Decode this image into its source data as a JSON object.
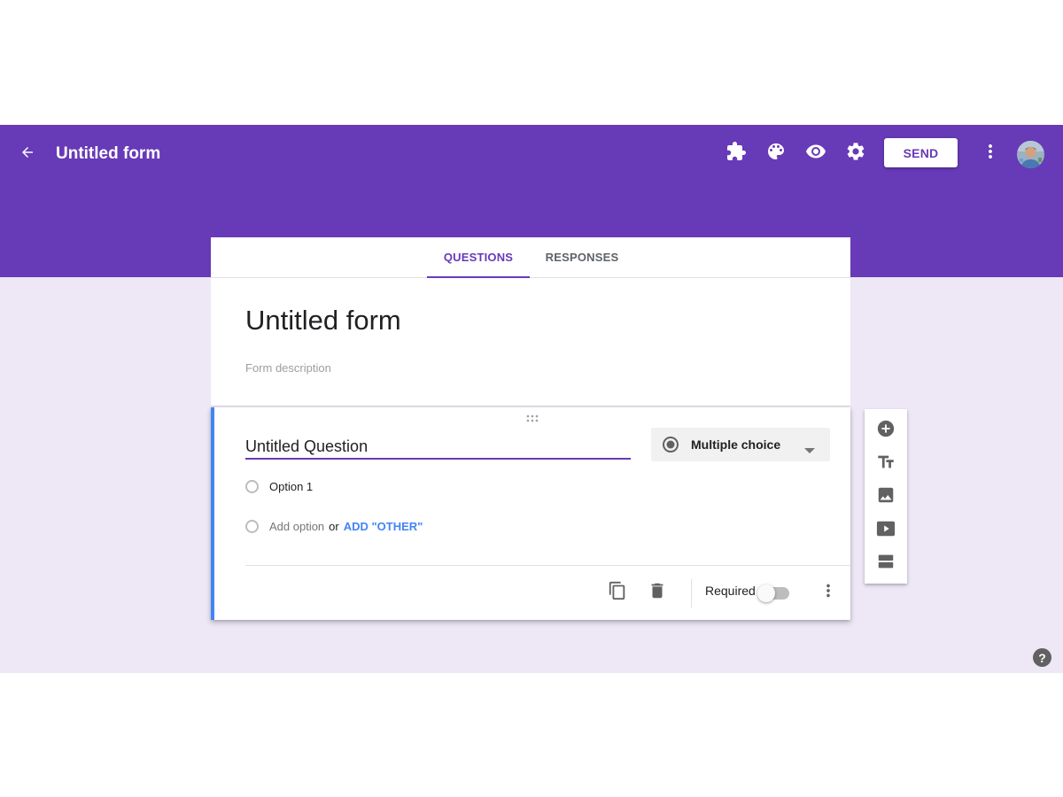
{
  "header": {
    "title": "Untitled form",
    "send_label": "SEND",
    "icons": [
      "back-arrow-icon",
      "puzzle-addons-icon",
      "palette-icon",
      "eye-preview-icon",
      "gear-icon",
      "more-vert-icon"
    ],
    "color": "#673ab7"
  },
  "tabs": [
    {
      "label": "QUESTIONS",
      "active": true
    },
    {
      "label": "RESPONSES",
      "active": false
    }
  ],
  "form": {
    "title": "Untitled form",
    "description_placeholder": "Form description"
  },
  "question": {
    "title": "Untitled Question",
    "type_label": "Multiple choice",
    "options": [
      "Option 1"
    ],
    "add_option_label": "Add option",
    "or_label": "or",
    "add_other_label": "ADD \"OTHER\"",
    "required_label": "Required",
    "required": false
  },
  "side_toolbar": {
    "icons": [
      "add-question-icon",
      "title-text-icon",
      "image-icon",
      "video-icon",
      "section-icon"
    ]
  },
  "help_label": "?",
  "colors": {
    "accent": "#673ab7",
    "background": "#ede7f6",
    "card_focus": "#4285f4",
    "link": "#4285f4"
  }
}
